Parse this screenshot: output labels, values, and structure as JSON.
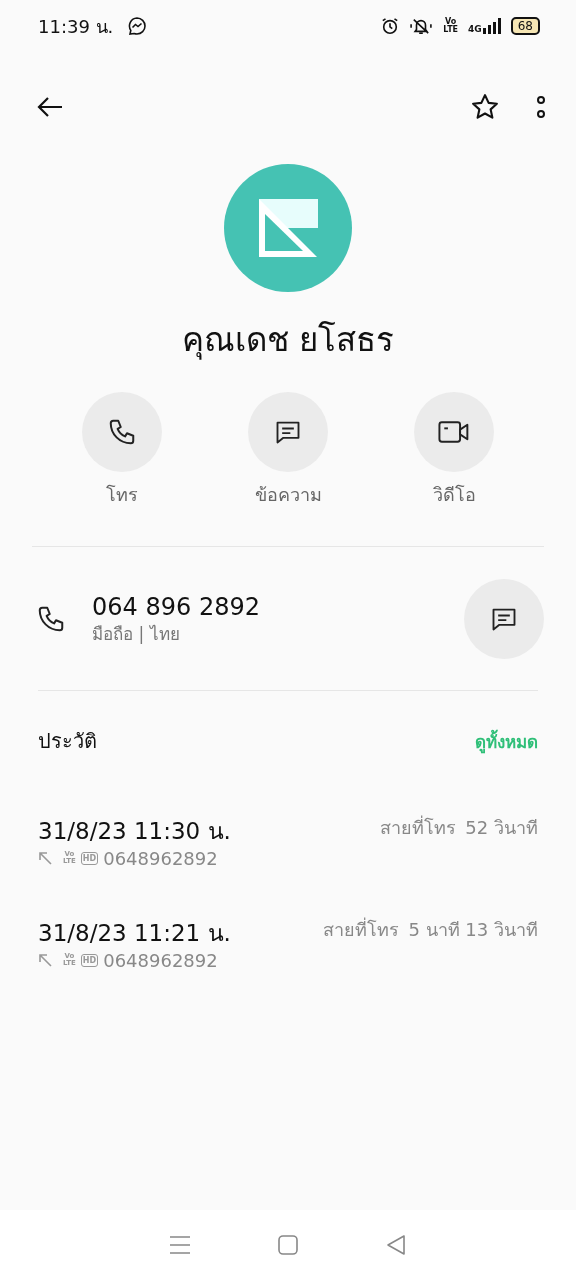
{
  "status_bar": {
    "time": "11:39 น.",
    "volte": [
      "Vo",
      "LTE"
    ],
    "network": "4G",
    "battery": "68"
  },
  "contact": {
    "name": "คุณเดช ยโสธร"
  },
  "actions": [
    {
      "kind": "call",
      "label": "โทร"
    },
    {
      "kind": "message",
      "label": "ข้อความ"
    },
    {
      "kind": "video",
      "label": "วิดีโอ"
    }
  ],
  "phone": {
    "number": "064 896 2892",
    "detail": "มือถือ | ไทย"
  },
  "history": {
    "title": "ประวัติ",
    "view_all": "ดูทั้งหมด",
    "entries": [
      {
        "datetime": "31/8/23 11:30 น.",
        "volte": [
          "Vo",
          "LTE"
        ],
        "hd": "HD",
        "number": "0648962892",
        "type": "สายที่โทร",
        "duration": "52 วินาที"
      },
      {
        "datetime": "31/8/23 11:21 น.",
        "volte": [
          "Vo",
          "LTE"
        ],
        "hd": "HD",
        "number": "0648962892",
        "type": "สายที่โทร",
        "duration": "5 นาที 13 วินาที"
      }
    ]
  }
}
